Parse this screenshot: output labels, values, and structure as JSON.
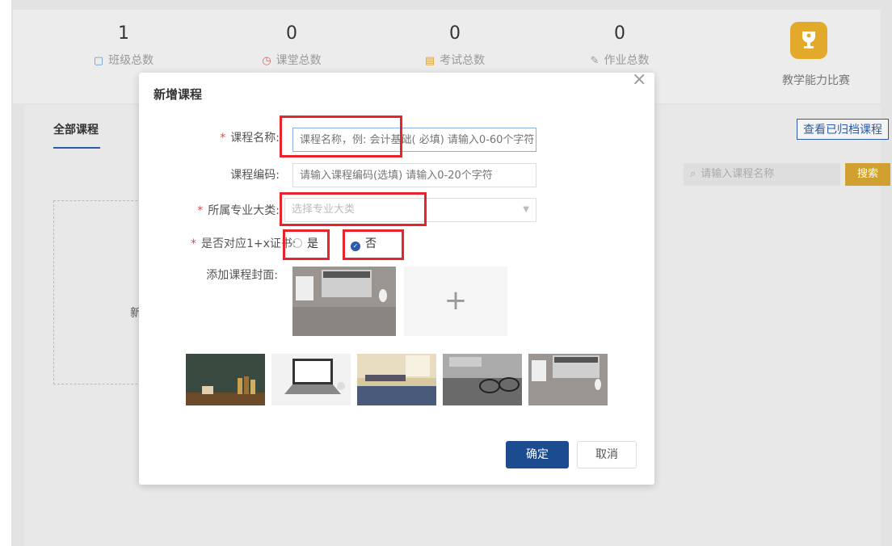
{
  "stats": [
    {
      "value": "1",
      "label": "班级总数",
      "icon": "class-icon",
      "icon_glyph": "▢",
      "icon_color": "#5b9bd5"
    },
    {
      "value": "0",
      "label": "课堂总数",
      "icon": "clock-icon",
      "icon_glyph": "◷",
      "icon_color": "#e06060"
    },
    {
      "value": "0",
      "label": "考试总数",
      "icon": "exam-icon",
      "icon_glyph": "▤",
      "icon_color": "#e0a030"
    },
    {
      "value": "0",
      "label": "作业总数",
      "icon": "homework-icon",
      "icon_glyph": "✎",
      "icon_color": "#999999"
    }
  ],
  "contest": {
    "label": "教学能力比赛",
    "icon": "trophy-icon",
    "icon_glyph": "🏆"
  },
  "tabs": {
    "all_courses": "全部课程"
  },
  "archive_button": "查看已归档课程",
  "search": {
    "placeholder": "请输入课程名称",
    "button": "搜索",
    "icon": "search-icon"
  },
  "new_course_card": "新",
  "modal": {
    "title": "新增课程",
    "close": "×",
    "fields": {
      "course_name": {
        "label": "课程名称:",
        "placeholder": "课程名称，例: 会计基础( 必填) 请输入0-60个字符",
        "required": true
      },
      "course_code": {
        "label": "课程编码:",
        "placeholder": "请输入课程编码(选填) 请输入0-20个字符",
        "required": false
      },
      "major_category": {
        "label": "所属专业大类:",
        "placeholder": "选择专业大类",
        "required": true
      },
      "cert_1x": {
        "label": "是否对应1+x证书:",
        "required": true,
        "options": [
          "是",
          "否"
        ],
        "selected": "否"
      },
      "cover": {
        "label": "添加课程封面:",
        "add_symbol": "+"
      }
    },
    "buttons": {
      "confirm": "确定",
      "cancel": "取消"
    }
  },
  "colors": {
    "primary": "#1d4b8f",
    "accent": "#d1a030",
    "annotation": "#e8232b"
  }
}
